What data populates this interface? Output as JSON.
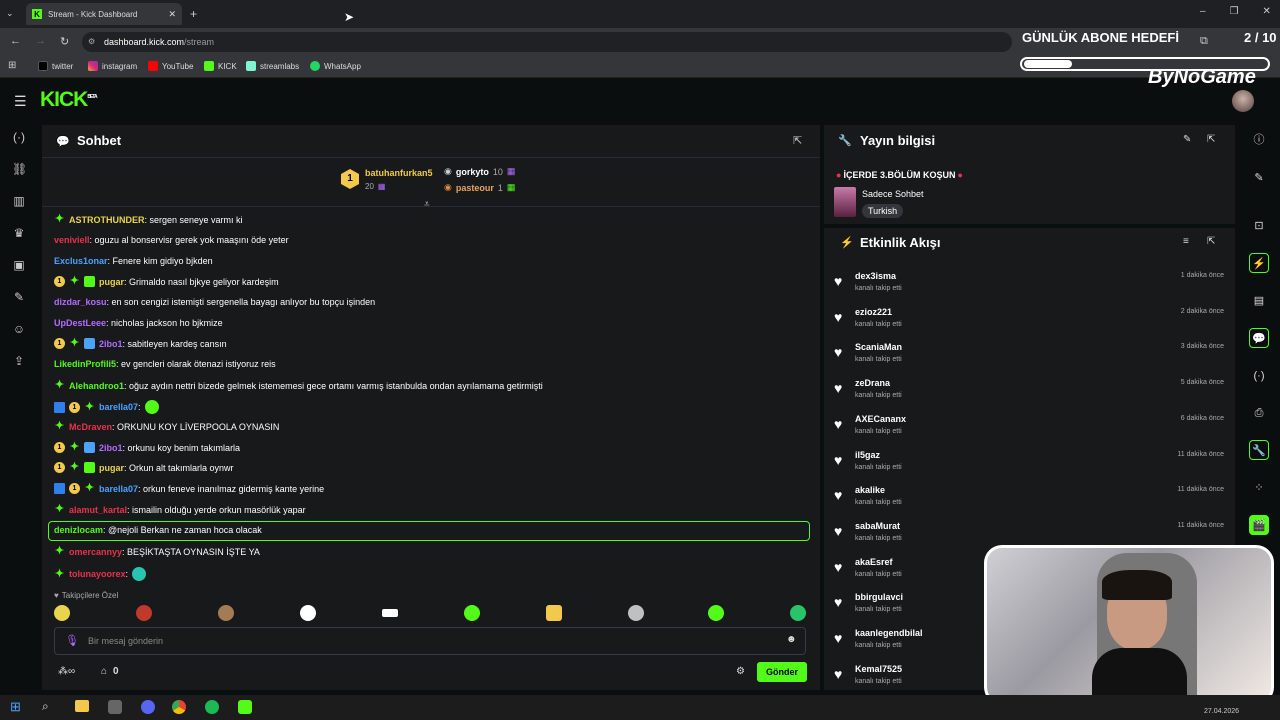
{
  "browser": {
    "tab_title": "Stream - Kick Dashboard",
    "url_host": "dashboard.kick.com",
    "url_path": "/stream",
    "bookmarks": [
      "twitter",
      "instagram",
      "YouTube",
      "KICK",
      "streamlabs",
      "WhatsApp"
    ]
  },
  "app": {
    "logo": "KICK",
    "logo_sup": "BETA",
    "brand_color": "#53fc18"
  },
  "chat": {
    "title": "Sohbet",
    "pinned": {
      "first": {
        "rank": "1",
        "name": "batuhanfurkan5",
        "count": "20"
      },
      "second": {
        "name": "gorkyto",
        "count": "10"
      },
      "third": {
        "name": "pasteour",
        "count": "1"
      }
    },
    "messages": [
      {
        "user": "ASTROTHUNDER",
        "color": "#e8d44d",
        "text": ": sergen seneye varmı ki"
      },
      {
        "user": "veniviell",
        "color": "#e8324d",
        "text": ": oguzu al bonservisr gerek yok maaşını öde yeter"
      },
      {
        "user": "Exclus1onar",
        "color": "#4aa3ff",
        "text": ": Fenere kim gidiyo bjkden"
      },
      {
        "user": "pugar",
        "color": "#e8d44d",
        "text": ": Grimaldo nasıl bjkye geliyor kardeşim"
      },
      {
        "user": "dizdar_kosu",
        "color": "#b46cff",
        "text": ": en son cengizi istemişti sergenella bayagı anlıyor bu topçu işinden"
      },
      {
        "user": "UpDestLeee",
        "color": "#b46cff",
        "text": ": nicholas jackson ho bjkmize"
      },
      {
        "user": "2ibo1",
        "color": "#b46cff",
        "text": ": sabitleyen kardeş cansın"
      },
      {
        "user": "LikedinProfili5",
        "color": "#53fc18",
        "text": ": ev gencleri olarak ötenazi istiyoruz reis"
      },
      {
        "user": "Alehandroo1",
        "color": "#53fc18",
        "text": ": oğuz aydın nettri bizede gelmek istememesi gece ortamı varmış istanbulda ondan ayrılamama getirmişti"
      },
      {
        "user": "barella07",
        "color": "#4aa3ff",
        "text": ":"
      },
      {
        "user": "McDraven",
        "color": "#e8324d",
        "text": ": ORKUNU KOY LİVERPOOLA OYNASIN"
      },
      {
        "user": "2ibo1",
        "color": "#b46cff",
        "text": ": orkunu koy benim takımlarla"
      },
      {
        "user": "pugar",
        "color": "#e8d44d",
        "text": ": Orkun alt takımlarla oynwr"
      },
      {
        "user": "barella07",
        "color": "#4aa3ff",
        "text": ": orkun feneve inanılmaz gidermiş kante yerine"
      },
      {
        "user": "alamut_kartal",
        "color": "#e8324d",
        "text": ": ismailin olduğu yerde orkun masörlük yapar"
      },
      {
        "user": "denizlocam",
        "color": "#53fc18",
        "text": ": @nejoli Berkan ne zaman hoca olacak"
      },
      {
        "user": "omercannyy",
        "color": "#e8324d",
        "text": ": BEŞİKTAŞTA OYNASIN İŞTE YA"
      },
      {
        "user": "tolunayoorex",
        "color": "#e8324d",
        "text": ":"
      }
    ],
    "emotes_label": "Takipçilere Özel",
    "input_placeholder": "Bir mesaj gönderin",
    "footer_count": "0",
    "send_label": "Gönder"
  },
  "stream_info": {
    "title": "Yayın bilgisi",
    "stream_title": "İÇERDE 3.BÖLÜM KOŞUN",
    "category": "Sadece Sohbet",
    "language": "Turkish"
  },
  "activity": {
    "title": "Etkinlik Akışı",
    "events": [
      {
        "user": "dex3isma",
        "action": "kanalı takip etti",
        "time": "1 dakika önce"
      },
      {
        "user": "ezioz221",
        "action": "kanalı takip etti",
        "time": "2 dakika önce"
      },
      {
        "user": "ScaniaMan",
        "action": "kanalı takip etti",
        "time": "3 dakika önce"
      },
      {
        "user": "zeDrana",
        "action": "kanalı takip etti",
        "time": "5 dakika önce"
      },
      {
        "user": "AXECananx",
        "action": "kanalı takip etti",
        "time": "6 dakika önce"
      },
      {
        "user": "il5gaz",
        "action": "kanalı takip etti",
        "time": "11 dakika önce"
      },
      {
        "user": "akalike",
        "action": "kanalı takip etti",
        "time": "11 dakika önce"
      },
      {
        "user": "sabaMurat",
        "action": "kanalı takip etti",
        "time": "11 dakika önce"
      },
      {
        "user": "akaEsref",
        "action": "kanalı takip etti",
        "time": ""
      },
      {
        "user": "bbirgulavci",
        "action": "kanalı takip etti",
        "time": ""
      },
      {
        "user": "kaanlegendbilal",
        "action": "kanalı takip etti",
        "time": ""
      },
      {
        "user": "Kemal7525",
        "action": "kanalı takip etti",
        "time": ""
      }
    ]
  },
  "overlay": {
    "goal_label": "GÜNLÜK ABONE HEDEFİ",
    "goal_count": "2 / 10",
    "goal_progress": 0.2,
    "brand": "ByNoGame"
  },
  "taskbar": {
    "date": "27.04.2026"
  }
}
